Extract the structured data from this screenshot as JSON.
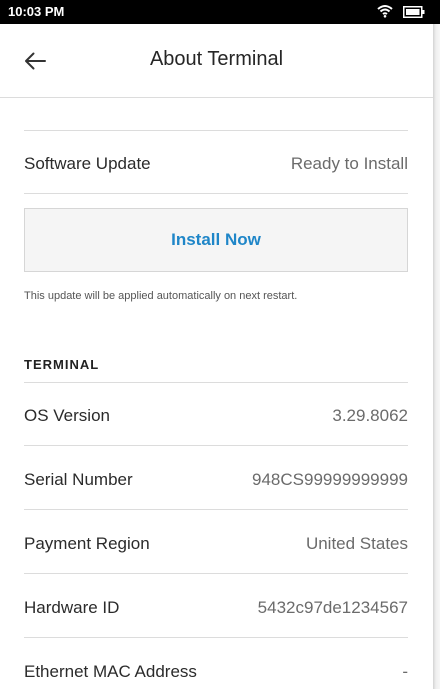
{
  "status_bar": {
    "time": "10:03 PM",
    "wifi_icon": "wifi-icon",
    "battery_icon": "battery-icon"
  },
  "header": {
    "back_icon": "back-arrow-icon",
    "title": "About Terminal"
  },
  "software_update": {
    "label": "Software Update",
    "value": "Ready to Install",
    "install_label": "Install Now",
    "note": "This update will be applied automatically on next restart."
  },
  "terminal": {
    "section_title": "TERMINAL",
    "rows": [
      {
        "label": "OS Version",
        "value": "3.29.8062"
      },
      {
        "label": "Serial Number",
        "value": "948CS99999999999"
      },
      {
        "label": "Payment Region",
        "value": "United States"
      },
      {
        "label": "Hardware ID",
        "value": "5432c97de1234567"
      },
      {
        "label": "Ethernet MAC Address",
        "value": "-"
      }
    ]
  },
  "colors": {
    "accent": "#1f86c8",
    "text": "#2b2b2b",
    "secondary_text": "#6b6b6b",
    "divider": "#dcdcdc"
  }
}
